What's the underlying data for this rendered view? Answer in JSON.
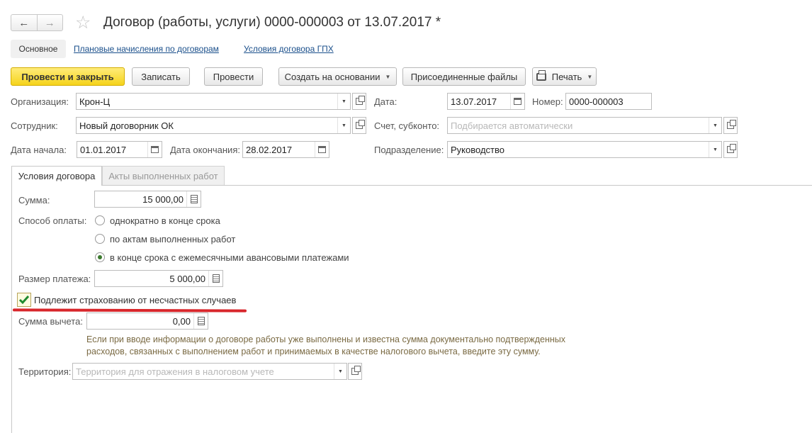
{
  "header": {
    "back_label": "←",
    "forward_label": "→",
    "star_icon": "star-icon",
    "title": "Договор (работы, услуги) 0000-000003 от 13.07.2017 *"
  },
  "sections": {
    "main": "Основное",
    "planned": "Плановые начисления по договорам",
    "terms": "Условия договора ГПХ"
  },
  "toolbar": {
    "post_close": "Провести и закрыть",
    "save": "Записать",
    "post": "Провести",
    "create_based": "Создать на основании",
    "attached": "Присоединенные файлы",
    "print": "Печать"
  },
  "form": {
    "org_label": "Организация:",
    "org_value": "Крон-Ц",
    "date_label": "Дата:",
    "date_value": "13.07.2017",
    "number_label": "Номер:",
    "number_value": "0000-000003",
    "employee_label": "Сотрудник:",
    "employee_value": "Новый договорник ОК",
    "account_label": "Счет, субконто:",
    "account_placeholder": "Подбирается автоматически",
    "start_label": "Дата начала:",
    "start_value": "01.01.2017",
    "end_label": "Дата окончания:",
    "end_value": "28.02.2017",
    "dept_label": "Подразделение:",
    "dept_value": "Руководство"
  },
  "tabs": {
    "conditions": "Условия договора",
    "acts": "Акты выполненных работ"
  },
  "conditions": {
    "sum_label": "Сумма:",
    "sum_value": "15 000,00",
    "pay_method_label": "Способ оплаты:",
    "options": [
      "однократно в конце срока",
      "по актам выполненных работ",
      "в конце срока с ежемесячными авансовыми платежами"
    ],
    "selected_option": 2,
    "payment_label": "Размер платежа:",
    "payment_value": "5 000,00",
    "insurance_label": "Подлежит страхованию от несчастных случаев",
    "insurance_checked": true,
    "deduction_label": "Сумма вычета:",
    "deduction_value": "0,00",
    "hint": "Если при вводе информации о договоре работы уже выполнены и известна сумма документально подтвержденных расходов, связанных с выполнением работ и принимаемых в качестве налогового вычета, введите эту сумму.",
    "territory_label": "Территория:",
    "territory_placeholder": "Территория для отражения в налоговом учете"
  },
  "colors": {
    "primary_button": "#f5d31b",
    "link": "#1a4f8b",
    "annotation_line": "#d8262b",
    "hint_text": "#7a6a43"
  }
}
